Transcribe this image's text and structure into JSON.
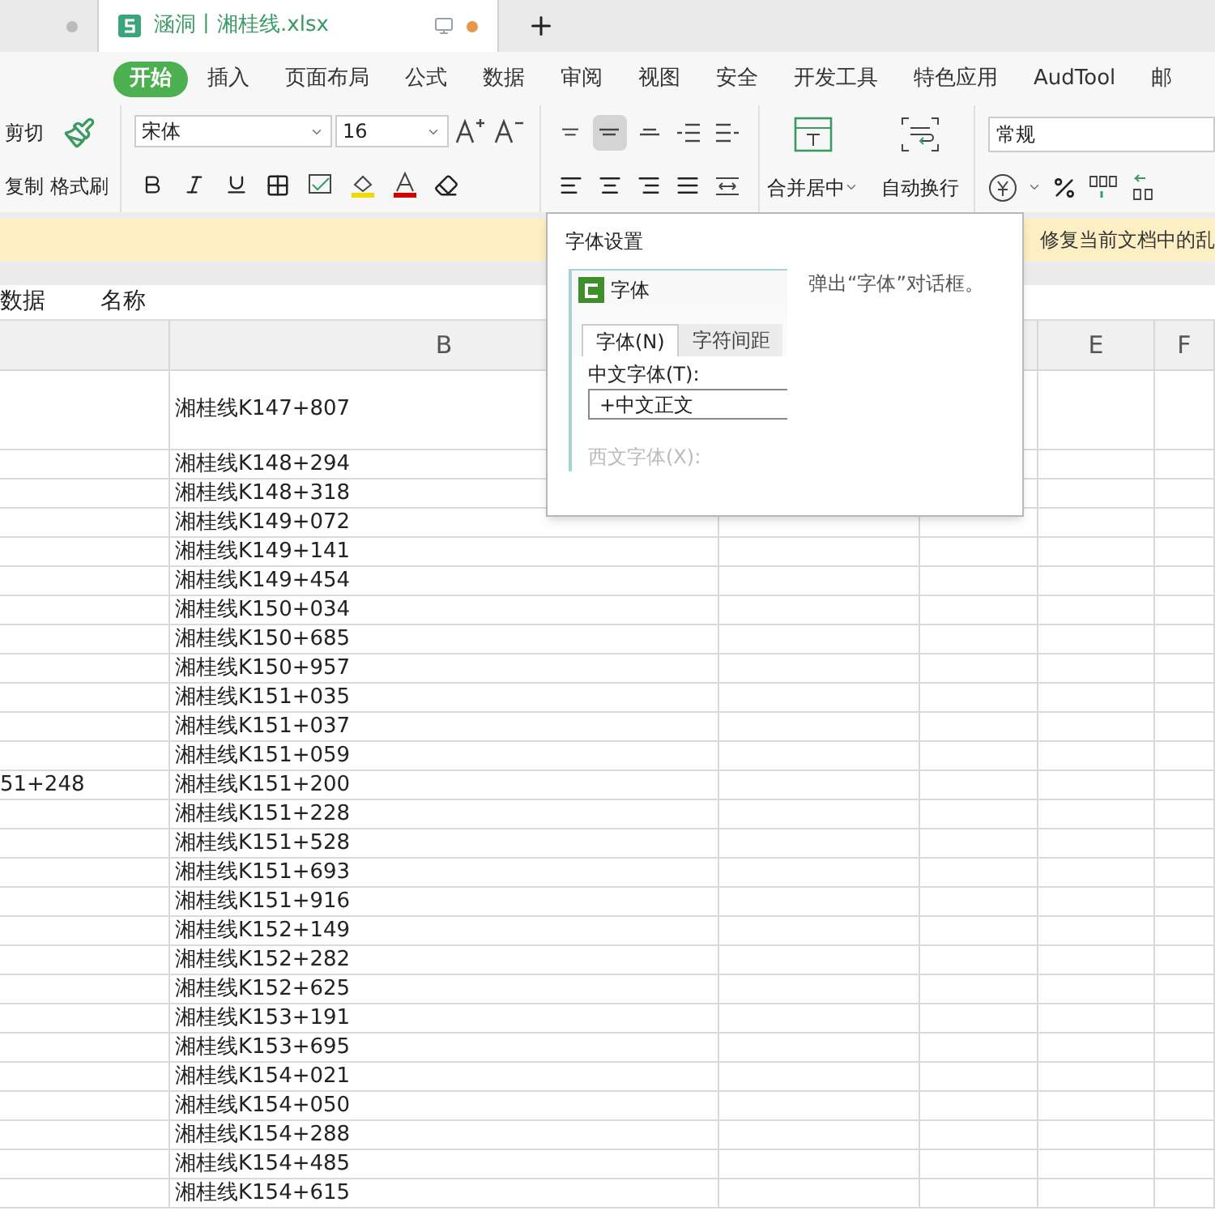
{
  "doc_tabs": [
    {
      "selected": false,
      "modified": false
    },
    {
      "label": "涵洞丨湘桂线.xlsx",
      "selected": true,
      "modified": true
    }
  ],
  "ribbon_tabs": [
    {
      "label": "开始",
      "selected": true
    },
    {
      "label": "插入",
      "selected": false
    },
    {
      "label": "页面布局",
      "selected": false
    },
    {
      "label": "公式",
      "selected": false
    },
    {
      "label": "数据",
      "selected": false
    },
    {
      "label": "审阅",
      "selected": false
    },
    {
      "label": "视图",
      "selected": false
    },
    {
      "label": "安全",
      "selected": false
    },
    {
      "label": "开发工具",
      "selected": false
    },
    {
      "label": "特色应用",
      "selected": false
    },
    {
      "label": "AudTool",
      "selected": false
    },
    {
      "label": "邮",
      "selected": false
    }
  ],
  "toolbar": {
    "cut": "剪切",
    "copy": "复制",
    "format_painter": "格式刷",
    "font": "宋体",
    "size": "16",
    "merge": "合并居中",
    "wrap": "自动换行",
    "number_format": "常规",
    "align_buttons": [
      {
        "selected": false
      },
      {
        "selected": true
      },
      {
        "selected": false
      },
      {
        "selected": false
      },
      {
        "selected": false
      }
    ]
  },
  "notice": "修复当前文档中的乱",
  "name_row": [
    "数据",
    "名称"
  ],
  "column_headers": [
    "B",
    "E",
    "F"
  ],
  "rows": [
    {
      "b": "湘桂线K147+807",
      "tall": true
    },
    {
      "b": "湘桂线K148+294"
    },
    {
      "b": "湘桂线K148+318"
    },
    {
      "b": "湘桂线K149+072"
    },
    {
      "b": "湘桂线K149+141"
    },
    {
      "b": "湘桂线K149+454"
    },
    {
      "b": "湘桂线K150+034"
    },
    {
      "b": "湘桂线K150+685"
    },
    {
      "b": "湘桂线K150+957"
    },
    {
      "b": "湘桂线K151+035"
    },
    {
      "b": "湘桂线K151+037"
    },
    {
      "b": "湘桂线K151+059"
    },
    {
      "a": "51+248",
      "b": "湘桂线K151+200"
    },
    {
      "b": "湘桂线K151+228"
    },
    {
      "b": "湘桂线K151+528"
    },
    {
      "b": "湘桂线K151+693"
    },
    {
      "b": "湘桂线K151+916"
    },
    {
      "b": "湘桂线K152+149"
    },
    {
      "b": "湘桂线K152+282"
    },
    {
      "b": "湘桂线K152+625"
    },
    {
      "b": "湘桂线K153+191"
    },
    {
      "b": "湘桂线K153+695"
    },
    {
      "b": "湘桂线K154+021"
    },
    {
      "b": "湘桂线K154+050"
    },
    {
      "b": "湘桂线K154+288"
    },
    {
      "b": "湘桂线K154+485"
    },
    {
      "b": "湘桂线K154+615"
    }
  ],
  "tooltip": {
    "title": "字体设置",
    "dialog_title": "字体",
    "dialog_tabs": [
      {
        "label": "字体(N)",
        "selected": true
      },
      {
        "label": "字符间距",
        "selected": false
      }
    ],
    "field_label": "中文字体(T):",
    "field_value": "+中文正文",
    "faded_label": "西文字体(X):",
    "description": "弹出“字体”对话框。"
  }
}
